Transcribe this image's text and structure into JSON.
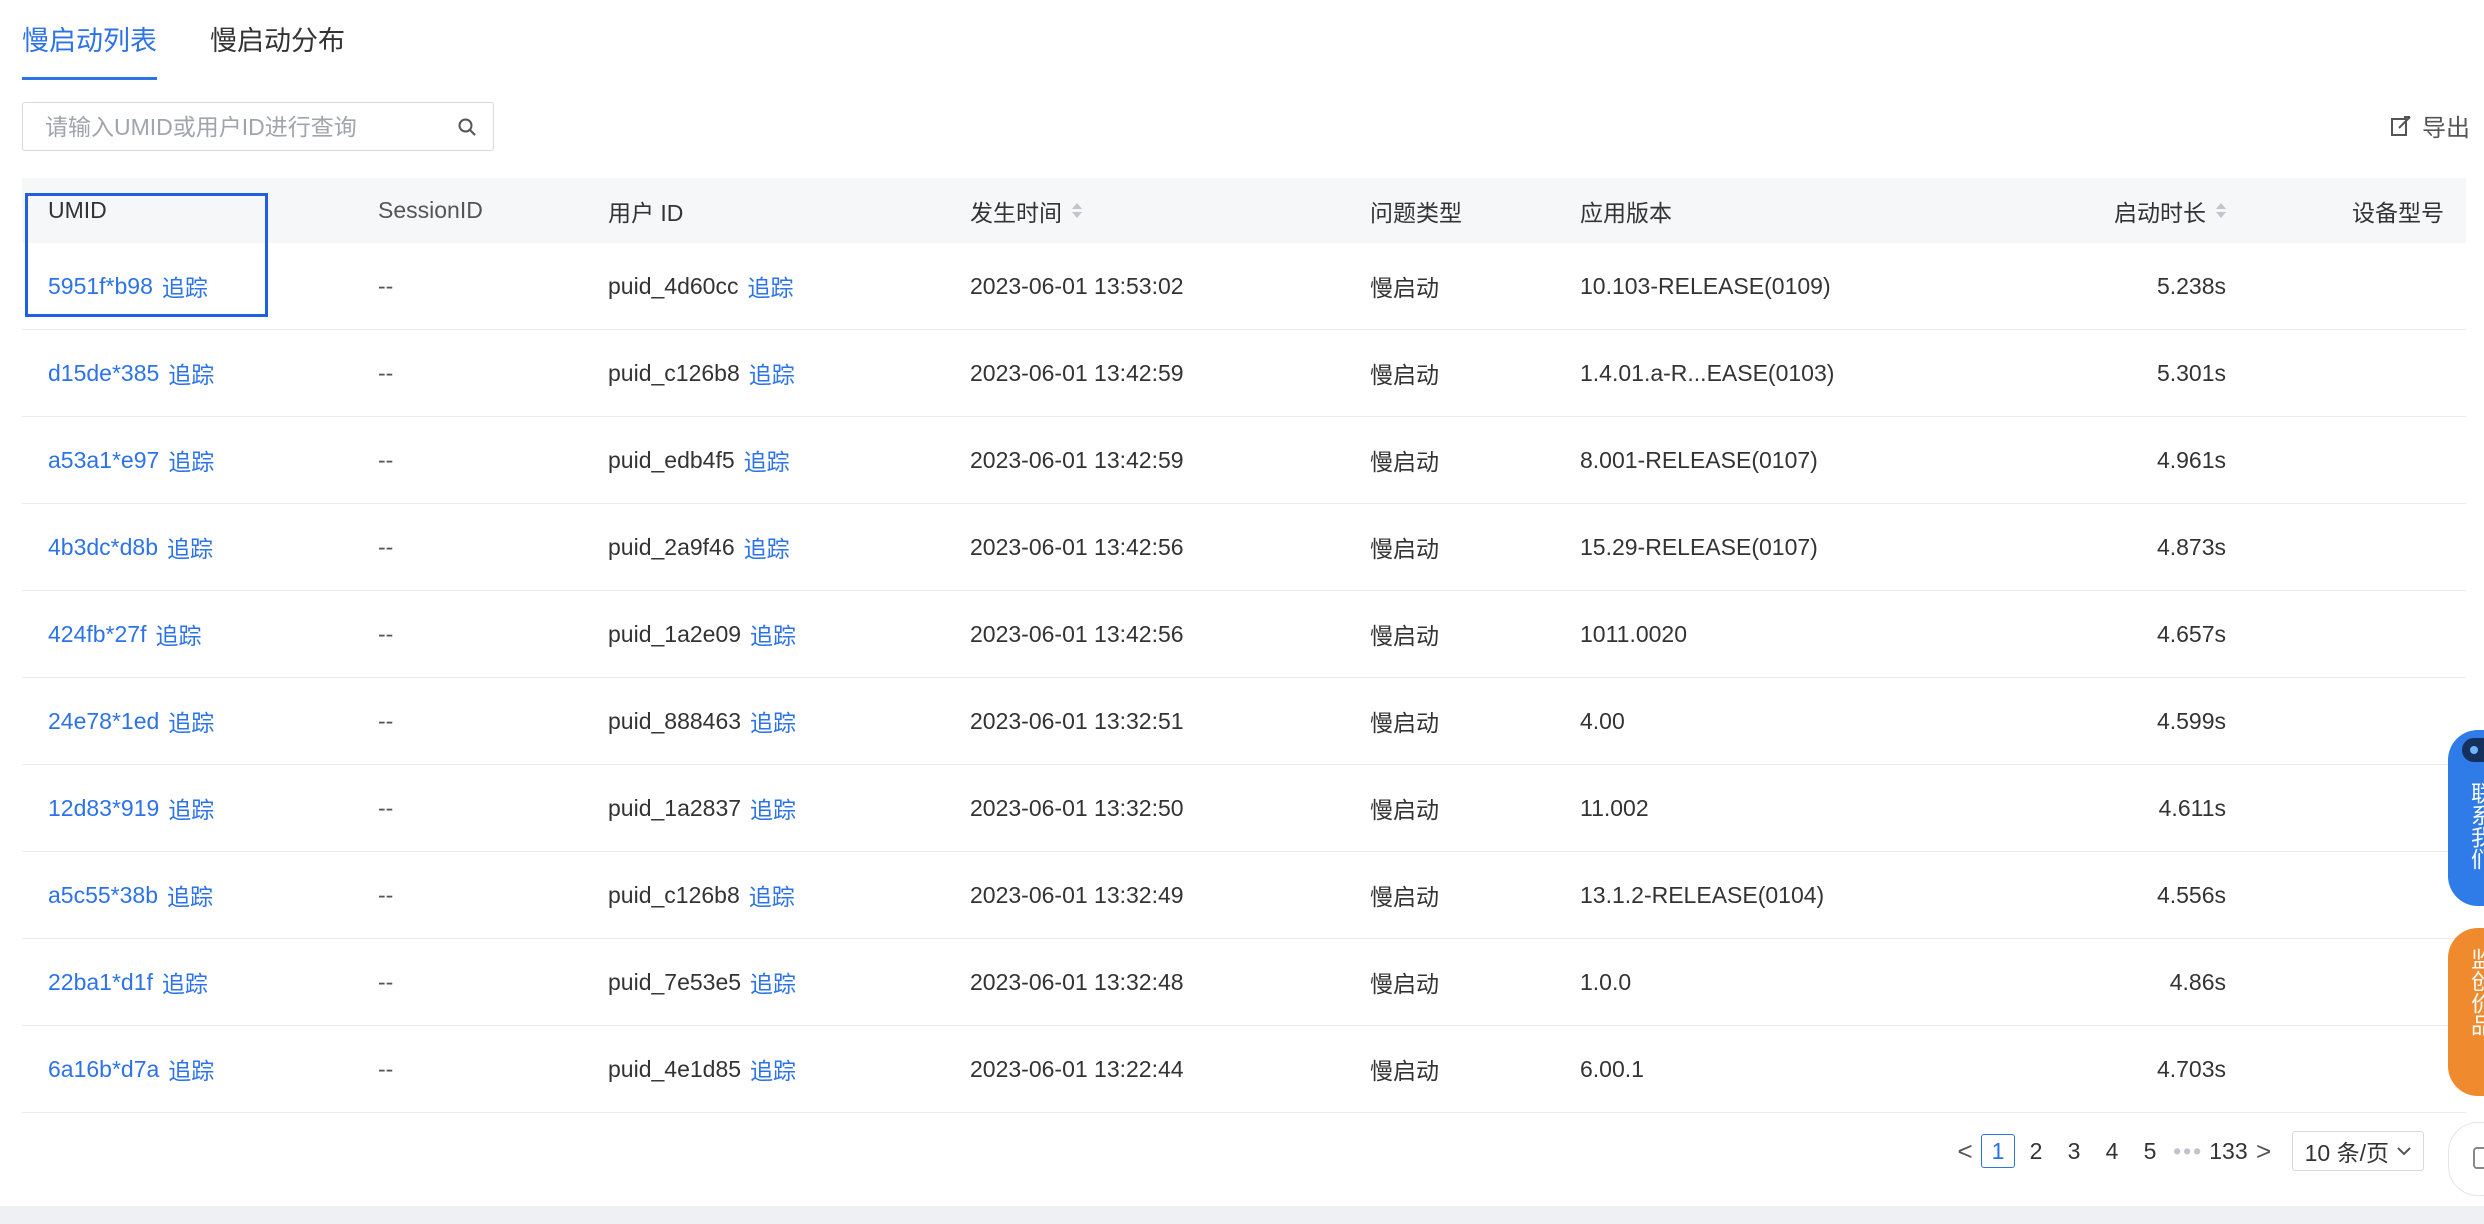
{
  "tabs": [
    {
      "label": "慢启动列表",
      "active": true
    },
    {
      "label": "慢启动分布",
      "active": false
    }
  ],
  "search": {
    "placeholder": "请输入UMID或用户ID进行查询",
    "icon": "search-icon"
  },
  "export": {
    "label": "导出",
    "icon": "export-icon"
  },
  "table": {
    "columns": {
      "umid": "UMID",
      "session": "SessionID",
      "user": "用户 ID",
      "time": "发生时间",
      "type": "问题类型",
      "version": "应用版本",
      "duration": "启动时长",
      "device": "设备型号"
    },
    "trace_label": "追踪",
    "rows": [
      {
        "umid": "5951f*b98",
        "session": "--",
        "user": "puid_4d60cc",
        "time": "2023-06-01 13:53:02",
        "type": "慢启动",
        "version": "10.103-RELEASE(0109)",
        "duration": "5.238s",
        "device": ""
      },
      {
        "umid": "d15de*385",
        "session": "--",
        "user": "puid_c126b8",
        "time": "2023-06-01 13:42:59",
        "type": "慢启动",
        "version": "1.4.01.a-R...EASE(0103)",
        "duration": "5.301s",
        "device": ""
      },
      {
        "umid": "a53a1*e97",
        "session": "--",
        "user": "puid_edb4f5",
        "time": "2023-06-01 13:42:59",
        "type": "慢启动",
        "version": "8.001-RELEASE(0107)",
        "duration": "4.961s",
        "device": ""
      },
      {
        "umid": "4b3dc*d8b",
        "session": "--",
        "user": "puid_2a9f46",
        "time": "2023-06-01 13:42:56",
        "type": "慢启动",
        "version": "15.29-RELEASE(0107)",
        "duration": "4.873s",
        "device": ""
      },
      {
        "umid": "424fb*27f",
        "session": "--",
        "user": "puid_1a2e09",
        "time": "2023-06-01 13:42:56",
        "type": "慢启动",
        "version": "1011.0020",
        "duration": "4.657s",
        "device": ""
      },
      {
        "umid": "24e78*1ed",
        "session": "--",
        "user": "puid_888463",
        "time": "2023-06-01 13:32:51",
        "type": "慢启动",
        "version": "4.00",
        "duration": "4.599s",
        "device": ""
      },
      {
        "umid": "12d83*919",
        "session": "--",
        "user": "puid_1a2837",
        "time": "2023-06-01 13:32:50",
        "type": "慢启动",
        "version": "11.002",
        "duration": "4.611s",
        "device": ""
      },
      {
        "umid": "a5c55*38b",
        "session": "--",
        "user": "puid_c126b8",
        "time": "2023-06-01 13:32:49",
        "type": "慢启动",
        "version": "13.1.2-RELEASE(0104)",
        "duration": "4.556s",
        "device": ""
      },
      {
        "umid": "22ba1*d1f",
        "session": "--",
        "user": "puid_7e53e5",
        "time": "2023-06-01 13:32:48",
        "type": "慢启动",
        "version": "1.0.0",
        "duration": "4.86s",
        "device": ""
      },
      {
        "umid": "6a16b*d7a",
        "session": "--",
        "user": "puid_4e1d85",
        "time": "2023-06-01 13:22:44",
        "type": "慢启动",
        "version": "6.00.1",
        "duration": "4.703s",
        "device": ""
      }
    ]
  },
  "pagination": {
    "prev": "<",
    "next": ">",
    "pages": [
      "1",
      "2",
      "3",
      "4",
      "5"
    ],
    "active_page": "1",
    "dots": "•••",
    "last": "133",
    "page_size": "10 条/页"
  },
  "floating": {
    "contact": "联系我们",
    "feedback": "监创价品"
  },
  "colors": {
    "accent": "#2d73e8",
    "highlight_border": "#1f5fe0",
    "float_blue": "#2f7be8",
    "float_orange": "#f08a2e"
  }
}
